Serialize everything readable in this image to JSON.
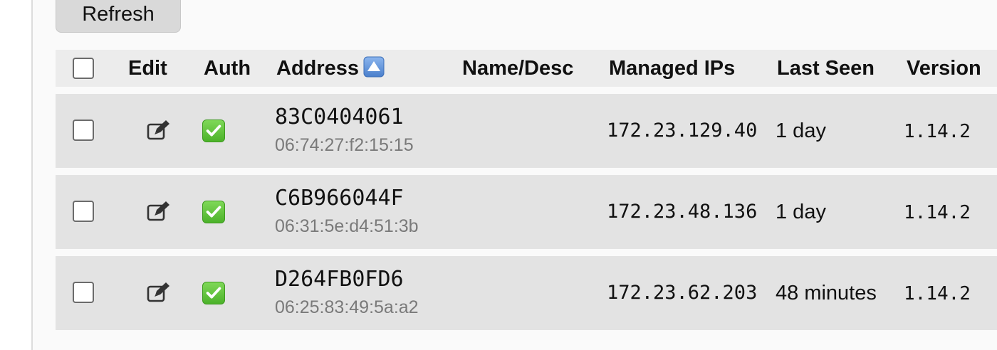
{
  "toolbar": {
    "refresh_label": "Refresh"
  },
  "table": {
    "headers": {
      "edit": "Edit",
      "auth": "Auth",
      "address": "Address",
      "name_desc": "Name/Desc",
      "managed_ips": "Managed IPs",
      "last_seen": "Last Seen",
      "version": "Version"
    },
    "sort": {
      "column": "address",
      "direction": "ascending",
      "icon": "sort-up-icon"
    },
    "rows": [
      {
        "address": "83C0404061",
        "mac": "06:74:27:f2:15:15",
        "name_desc": "",
        "managed_ip": "172.23.129.40",
        "last_seen": "1 day",
        "version": "1.14.2",
        "authorized": true,
        "selected": false
      },
      {
        "address": "C6B966044F",
        "mac": "06:31:5e:d4:51:3b",
        "name_desc": "",
        "managed_ip": "172.23.48.136",
        "last_seen": "1 day",
        "version": "1.14.2",
        "authorized": true,
        "selected": false
      },
      {
        "address": "D264FB0FD6",
        "mac": "06:25:83:49:5a:a2",
        "name_desc": "",
        "managed_ip": "172.23.62.203",
        "last_seen": "48 minutes",
        "version": "1.14.2",
        "authorized": true,
        "selected": false
      }
    ]
  },
  "colors": {
    "auth_check": "#4cb22a",
    "sort_badge": "#5b8fd6",
    "row_background": "#e3e3e3",
    "header_background": "#ececec"
  }
}
